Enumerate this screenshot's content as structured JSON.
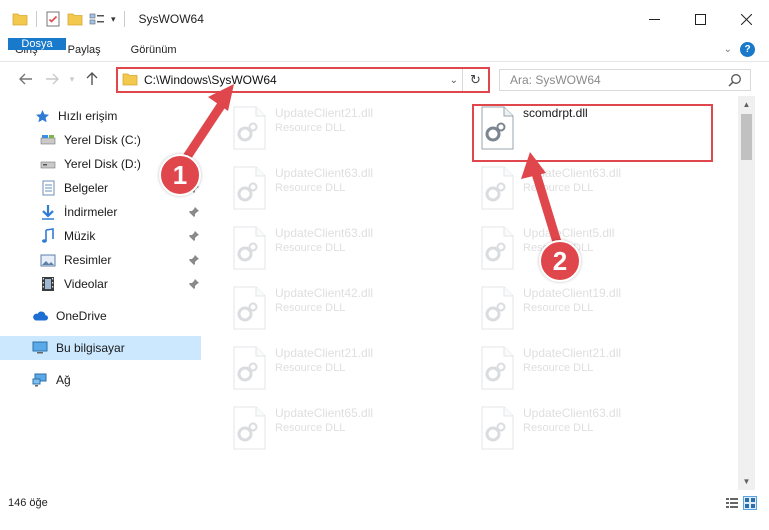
{
  "window": {
    "title": "SysWOW64"
  },
  "ribbon": {
    "tabs": [
      {
        "label": "Dosya",
        "file": true
      },
      {
        "label": "Giriş"
      },
      {
        "label": "Paylaş"
      },
      {
        "label": "Görünüm"
      }
    ],
    "help_label": "?"
  },
  "address": {
    "path": "C:\\Windows\\SysWOW64"
  },
  "search": {
    "placeholder": "Ara: SysWOW64"
  },
  "sidebar": {
    "items": [
      {
        "label": "Hızlı erişim",
        "icon": "star-icon",
        "pinned": false
      },
      {
        "label": "Yerel Disk (C:)",
        "icon": "drive-c-icon",
        "pinned": false
      },
      {
        "label": "Yerel Disk (D:)",
        "icon": "drive-d-icon",
        "pinned": false
      },
      {
        "label": "Belgeler",
        "icon": "documents-icon",
        "pinned": true
      },
      {
        "label": "İndirmeler",
        "icon": "downloads-icon",
        "pinned": true
      },
      {
        "label": "Müzik",
        "icon": "music-icon",
        "pinned": true
      },
      {
        "label": "Resimler",
        "icon": "pictures-icon",
        "pinned": true
      },
      {
        "label": "Videolar",
        "icon": "videos-icon",
        "pinned": true
      },
      {
        "label": "OneDrive",
        "icon": "onedrive-icon",
        "pinned": false
      },
      {
        "label": "Bu bilgisayar",
        "icon": "this-pc-icon",
        "pinned": false,
        "selected": true
      },
      {
        "label": "Ağ",
        "icon": "network-icon",
        "pinned": false
      }
    ]
  },
  "files": {
    "left_column": [
      {
        "name": "UpdateClient21.dll",
        "type": "Resource DLL"
      },
      {
        "name": "UpdateClient63.dll",
        "type": "Resource DLL"
      },
      {
        "name": "UpdateClient63.dll",
        "type": "Resource DLL"
      },
      {
        "name": "UpdateClient42.dll",
        "type": "Resource DLL"
      },
      {
        "name": "UpdateClient21.dll",
        "type": "Resource DLL"
      },
      {
        "name": "UpdateClient65.dll",
        "type": "Resource DLL"
      }
    ],
    "right_column": [
      {
        "name": "scomdrpt.dll",
        "type": "",
        "highlighted": true
      },
      {
        "name": "UpdateClient63.dll",
        "type": "Resource DLL"
      },
      {
        "name": "UpdateClient5.dll",
        "type": "Resource DLL"
      },
      {
        "name": "UpdateClient19.dll",
        "type": "Resource DLL"
      },
      {
        "name": "UpdateClient21.dll",
        "type": "Resource DLL"
      },
      {
        "name": "UpdateClient63.dll",
        "type": "Resource DLL"
      }
    ]
  },
  "status": {
    "item_count": "146 öğe"
  },
  "annotations": {
    "step1": "1",
    "step2": "2"
  },
  "colors": {
    "accent": "#1979ca",
    "annotation": "#e0474c",
    "selection": "#cce8ff"
  }
}
